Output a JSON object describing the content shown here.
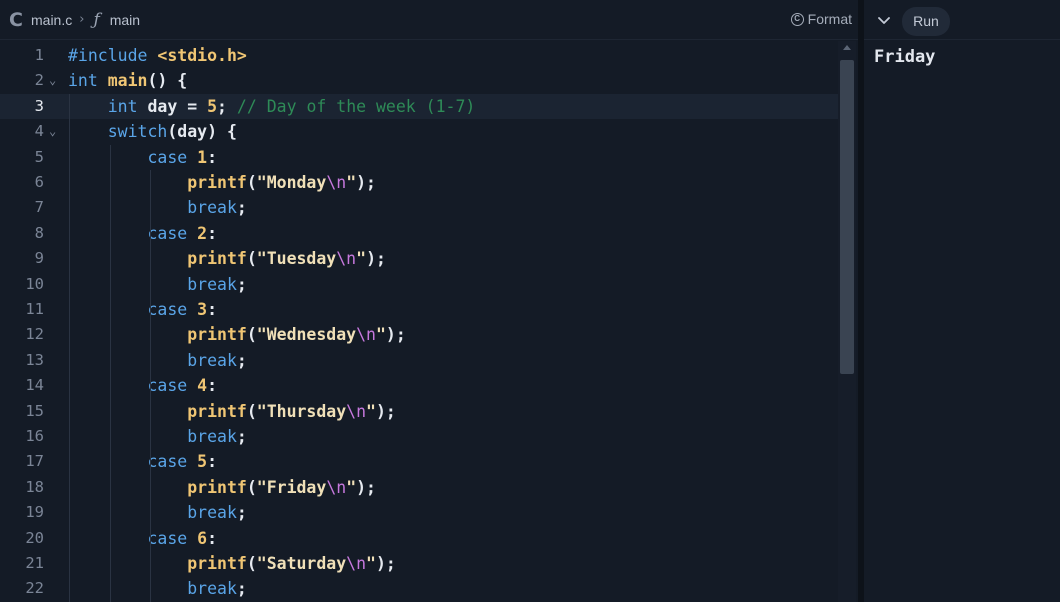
{
  "breadcrumb": {
    "file": "main.c",
    "separator": "›",
    "function_icon": "ƒ",
    "function": "main"
  },
  "toolbar": {
    "format_label": "Format",
    "run_label": "Run"
  },
  "output": {
    "text": "Friday"
  },
  "editor": {
    "active_line": 3,
    "lines": [
      {
        "n": "1"
      },
      {
        "n": "2"
      },
      {
        "n": "3"
      },
      {
        "n": "4"
      },
      {
        "n": "5"
      },
      {
        "n": "6"
      },
      {
        "n": "7"
      },
      {
        "n": "8"
      },
      {
        "n": "9"
      },
      {
        "n": "10"
      },
      {
        "n": "11"
      },
      {
        "n": "12"
      },
      {
        "n": "13"
      },
      {
        "n": "14"
      },
      {
        "n": "15"
      },
      {
        "n": "16"
      },
      {
        "n": "17"
      },
      {
        "n": "18"
      },
      {
        "n": "19"
      },
      {
        "n": "20"
      },
      {
        "n": "21"
      },
      {
        "n": "22"
      }
    ],
    "code": [
      [
        [
          "pp",
          "#include "
        ],
        [
          "inc",
          "<stdio.h>"
        ]
      ],
      [
        [
          "kw",
          "int "
        ],
        [
          "fn",
          "main"
        ],
        [
          "pl",
          "() {"
        ]
      ],
      [
        [
          "pl",
          "    "
        ],
        [
          "kw",
          "int "
        ],
        [
          "pl",
          "day = "
        ],
        [
          "num",
          "5"
        ],
        [
          "pl",
          "; "
        ],
        [
          "cm",
          "// Day of the week (1-7)"
        ]
      ],
      [
        [
          "pl",
          "    "
        ],
        [
          "kw",
          "switch"
        ],
        [
          "pl",
          "(day) {"
        ]
      ],
      [
        [
          "pl",
          "        "
        ],
        [
          "kw",
          "case "
        ],
        [
          "num",
          "1"
        ],
        [
          "pl",
          ":"
        ]
      ],
      [
        [
          "pl",
          "            "
        ],
        [
          "fn",
          "printf"
        ],
        [
          "pl",
          "("
        ],
        [
          "str",
          "\"Monday"
        ],
        [
          "esc",
          "\\n"
        ],
        [
          "str",
          "\""
        ],
        [
          "pl",
          ");"
        ]
      ],
      [
        [
          "pl",
          "            "
        ],
        [
          "kw",
          "break"
        ],
        [
          "pl",
          ";"
        ]
      ],
      [
        [
          "pl",
          "        "
        ],
        [
          "kw",
          "case "
        ],
        [
          "num",
          "2"
        ],
        [
          "pl",
          ":"
        ]
      ],
      [
        [
          "pl",
          "            "
        ],
        [
          "fn",
          "printf"
        ],
        [
          "pl",
          "("
        ],
        [
          "str",
          "\"Tuesday"
        ],
        [
          "esc",
          "\\n"
        ],
        [
          "str",
          "\""
        ],
        [
          "pl",
          ");"
        ]
      ],
      [
        [
          "pl",
          "            "
        ],
        [
          "kw",
          "break"
        ],
        [
          "pl",
          ";"
        ]
      ],
      [
        [
          "pl",
          "        "
        ],
        [
          "kw",
          "case "
        ],
        [
          "num",
          "3"
        ],
        [
          "pl",
          ":"
        ]
      ],
      [
        [
          "pl",
          "            "
        ],
        [
          "fn",
          "printf"
        ],
        [
          "pl",
          "("
        ],
        [
          "str",
          "\"Wednesday"
        ],
        [
          "esc",
          "\\n"
        ],
        [
          "str",
          "\""
        ],
        [
          "pl",
          ");"
        ]
      ],
      [
        [
          "pl",
          "            "
        ],
        [
          "kw",
          "break"
        ],
        [
          "pl",
          ";"
        ]
      ],
      [
        [
          "pl",
          "        "
        ],
        [
          "kw",
          "case "
        ],
        [
          "num",
          "4"
        ],
        [
          "pl",
          ":"
        ]
      ],
      [
        [
          "pl",
          "            "
        ],
        [
          "fn",
          "printf"
        ],
        [
          "pl",
          "("
        ],
        [
          "str",
          "\"Thursday"
        ],
        [
          "esc",
          "\\n"
        ],
        [
          "str",
          "\""
        ],
        [
          "pl",
          ");"
        ]
      ],
      [
        [
          "pl",
          "            "
        ],
        [
          "kw",
          "break"
        ],
        [
          "pl",
          ";"
        ]
      ],
      [
        [
          "pl",
          "        "
        ],
        [
          "kw",
          "case "
        ],
        [
          "num",
          "5"
        ],
        [
          "pl",
          ":"
        ]
      ],
      [
        [
          "pl",
          "            "
        ],
        [
          "fn",
          "printf"
        ],
        [
          "pl",
          "("
        ],
        [
          "str",
          "\"Friday"
        ],
        [
          "esc",
          "\\n"
        ],
        [
          "str",
          "\""
        ],
        [
          "pl",
          ");"
        ]
      ],
      [
        [
          "pl",
          "            "
        ],
        [
          "kw",
          "break"
        ],
        [
          "pl",
          ";"
        ]
      ],
      [
        [
          "pl",
          "        "
        ],
        [
          "kw",
          "case "
        ],
        [
          "num",
          "6"
        ],
        [
          "pl",
          ":"
        ]
      ],
      [
        [
          "pl",
          "            "
        ],
        [
          "fn",
          "printf"
        ],
        [
          "pl",
          "("
        ],
        [
          "str",
          "\"Saturday"
        ],
        [
          "esc",
          "\\n"
        ],
        [
          "str",
          "\""
        ],
        [
          "pl",
          ");"
        ]
      ],
      [
        [
          "pl",
          "            "
        ],
        [
          "kw",
          "break"
        ],
        [
          "pl",
          ";"
        ]
      ]
    ],
    "fold_lines": [
      2,
      4
    ],
    "fold_glyph": "⌄"
  },
  "colors": {
    "background": "#141b26",
    "keyword": "#5aa5e8",
    "function": "#f0c674",
    "comment": "#2e8b57",
    "escape": "#c678dd"
  }
}
